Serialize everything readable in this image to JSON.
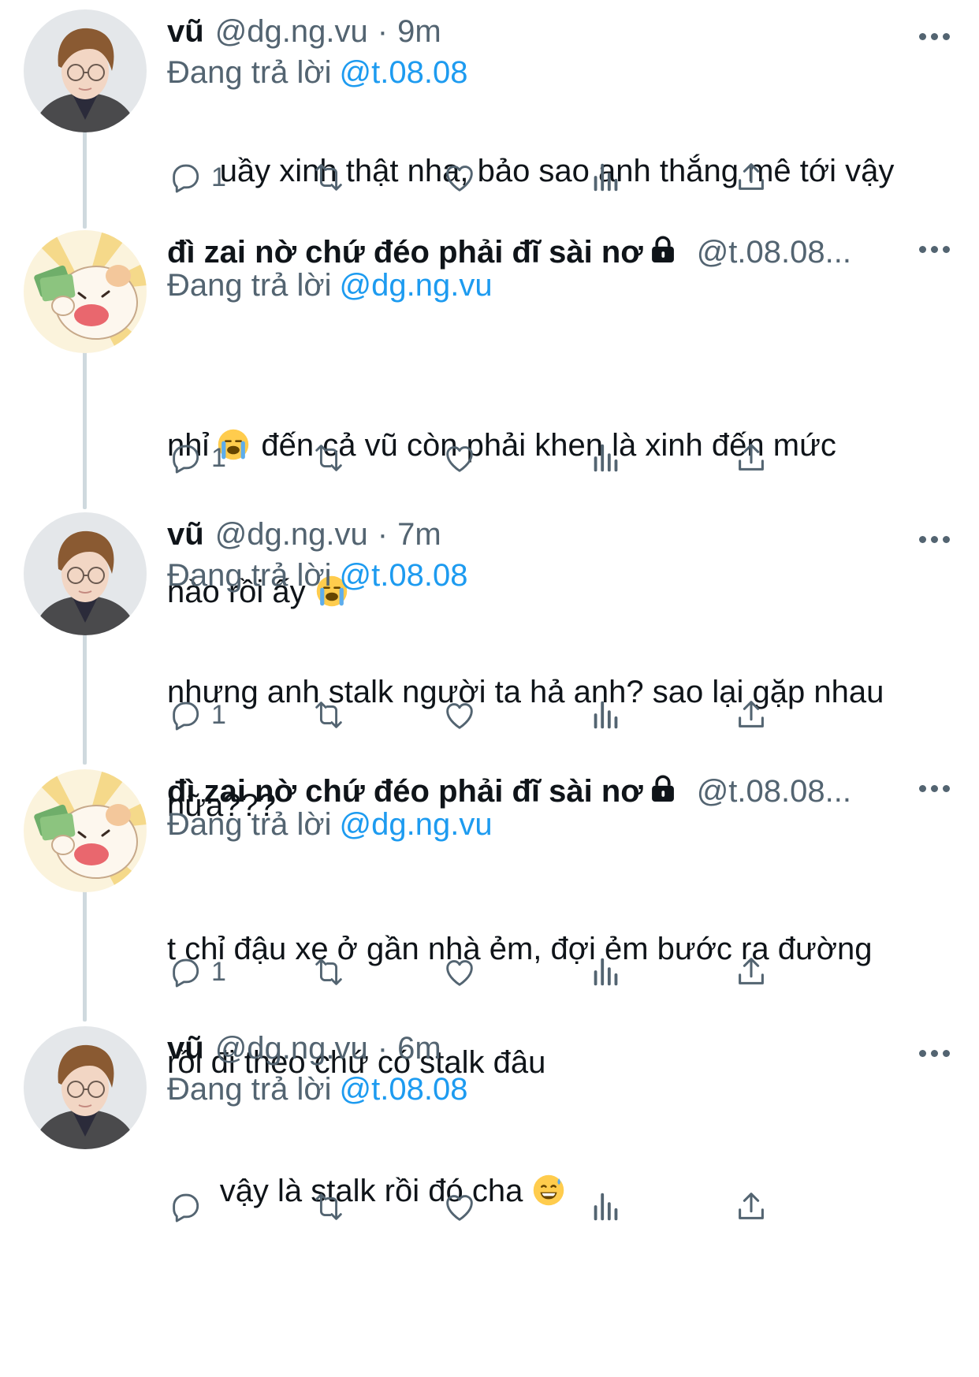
{
  "tweets": [
    {
      "name": "vũ",
      "handle": "@dg.ng.vu",
      "separator": "·",
      "time": "9m",
      "replying_label": "Đang trả lời",
      "replying_to": "@t.08.08",
      "text": "uầy xinh thật nha, bảo sao anh thắng mê tới vậy",
      "reply_count": "1",
      "avatar": "boy-glasses-avatar",
      "locked": false
    },
    {
      "name": "đì zai nờ chứ đéo phải đĩ sài nơ",
      "handle": "@t.08.08...",
      "replying_label": "Đang trả lời",
      "replying_to": "@dg.ng.vu",
      "text_lines": [
        "nhỉ",
        "đến cả vũ còn phải khen là xinh đến mức",
        "nào rồi ấy"
      ],
      "emoji": "loudly-crying-face",
      "reply_count": "1",
      "avatar": "cartoon-dog-money-avatar",
      "locked": true
    },
    {
      "name": "vũ",
      "handle": "@dg.ng.vu",
      "separator": "·",
      "time": "7m",
      "replying_label": "Đang trả lời",
      "replying_to": "@t.08.08",
      "text_lines": [
        "nhưng anh stalk người ta hả anh? sao lại gặp nhau",
        "nữa???"
      ],
      "reply_count": "1",
      "avatar": "boy-glasses-avatar",
      "locked": false
    },
    {
      "name": "đì zai nờ chứ đéo phải đĩ sài nơ",
      "handle": "@t.08.08...",
      "replying_label": "Đang trả lời",
      "replying_to": "@dg.ng.vu",
      "text_lines": [
        "t chỉ đậu xe ở gần nhà ẻm, đợi ẻm bước ra đường",
        "rồi đi theo chứ có stalk đâu"
      ],
      "reply_count": "1",
      "avatar": "cartoon-dog-money-avatar",
      "locked": true
    },
    {
      "name": "vũ",
      "handle": "@dg.ng.vu",
      "separator": "·",
      "time": "6m",
      "replying_label": "Đang trả lời",
      "replying_to": "@t.08.08",
      "text": "vậy là stalk rồi đó cha",
      "emoji": "grinning-face-with-sweat",
      "reply_count": "",
      "avatar": "boy-glasses-avatar",
      "locked": false
    }
  ],
  "icons": [
    "reply-icon",
    "retweet-icon",
    "like-icon",
    "views-icon",
    "share-icon",
    "more-icon",
    "lock-icon"
  ],
  "colors": {
    "text": "#0f1419",
    "muted": "#536471",
    "link": "#1d9bf0",
    "thread_line": "#cfd9de"
  }
}
